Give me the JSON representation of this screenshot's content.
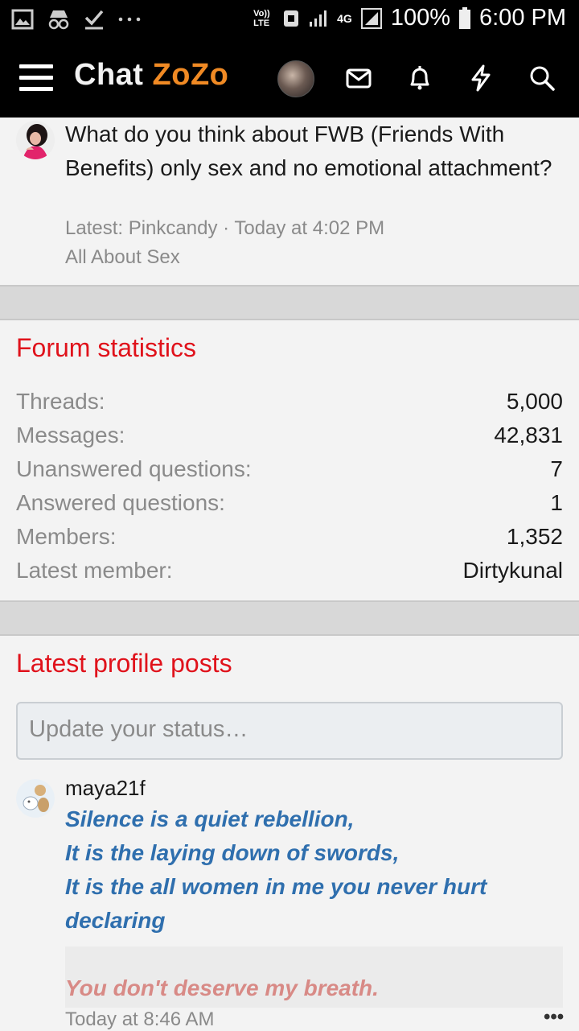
{
  "status_bar": {
    "left_icons": [
      "image-icon",
      "incognito-icon",
      "checkmark-icon",
      "more-dots-icon"
    ],
    "network_label": "Vo)) LTE",
    "network_type": "4G",
    "battery": "100%",
    "time": "6:00 PM"
  },
  "app_bar": {
    "logo_part1": "Chat",
    "logo_part2": "ZoZo",
    "icons": [
      "menu-icon",
      "user-avatar",
      "mail-icon",
      "bell-icon",
      "lightning-icon",
      "search-icon"
    ]
  },
  "thread": {
    "title": "What do you think about FWB (Friends With Benefits) only sex and no emotional attachment?",
    "meta": "Latest: Pinkcandy · Today at 4:02 PM",
    "forum": "All About Sex"
  },
  "forum_statistics": {
    "title": "Forum statistics",
    "rows": [
      {
        "label": "Threads:",
        "value": "5,000"
      },
      {
        "label": "Messages:",
        "value": "42,831"
      },
      {
        "label": "Unanswered questions:",
        "value": "7"
      },
      {
        "label": "Answered questions:",
        "value": "1"
      },
      {
        "label": "Members:",
        "value": "1,352"
      },
      {
        "label": "Latest member:",
        "value": "Dirtykunal"
      }
    ]
  },
  "profile_posts": {
    "title": "Latest profile posts",
    "status_placeholder": "Update your status…",
    "post": {
      "user": "maya21f",
      "lines": [
        "Silence is a quiet rebellion,",
        "It is the laying down of swords,",
        "It is the all women in me you never hurt",
        "declaring"
      ],
      "quote": "You don't deserve my breath.",
      "time": "Today at 8:46 AM",
      "more": "•••"
    }
  },
  "colors": {
    "accent_red": "#e0121b",
    "logo_orange": "#f08a24",
    "post_blue": "#2f6fae",
    "quote_pink": "#d88a86"
  }
}
